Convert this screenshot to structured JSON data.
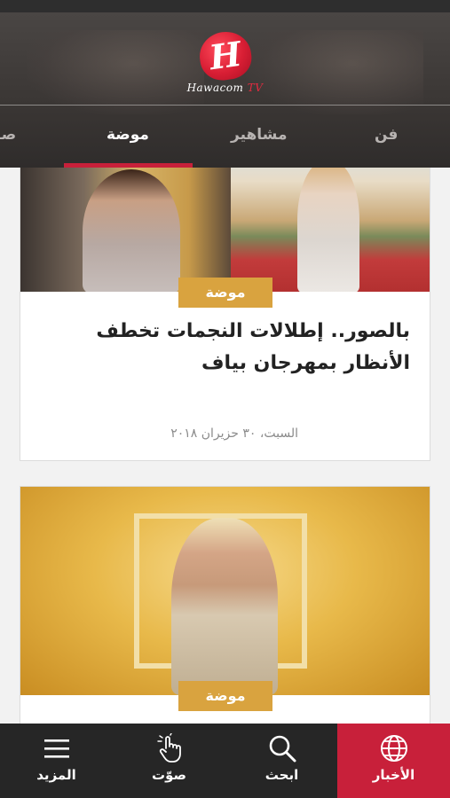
{
  "app": {
    "logo_letter": "H",
    "logo_name": "Hawacom",
    "logo_suffix": "TV"
  },
  "tabs": [
    {
      "label": "فن",
      "active": false
    },
    {
      "label": "مشاهير",
      "active": false
    },
    {
      "label": "موضة",
      "active": true
    },
    {
      "label": "صـ",
      "active": false
    }
  ],
  "articles": [
    {
      "category": "موضة",
      "title": "بالصور.. إطلالات النجمات تخطف الأنظار بمهرجان بياف",
      "date": "السبت، ٣٠ حزيران ٢٠١٨"
    },
    {
      "category": "موضة"
    }
  ],
  "bottom_nav": [
    {
      "label": "الأخبار",
      "icon": "globe-icon",
      "active": true
    },
    {
      "label": "ابحث",
      "icon": "search-icon",
      "active": false
    },
    {
      "label": "صوّت",
      "icon": "hand-pointer-icon",
      "active": false
    },
    {
      "label": "المزيد",
      "icon": "menu-icon",
      "active": false
    }
  ],
  "colors": {
    "accent": "#c8203a",
    "badge": "#d9a33f",
    "nav_bg": "#262626"
  }
}
